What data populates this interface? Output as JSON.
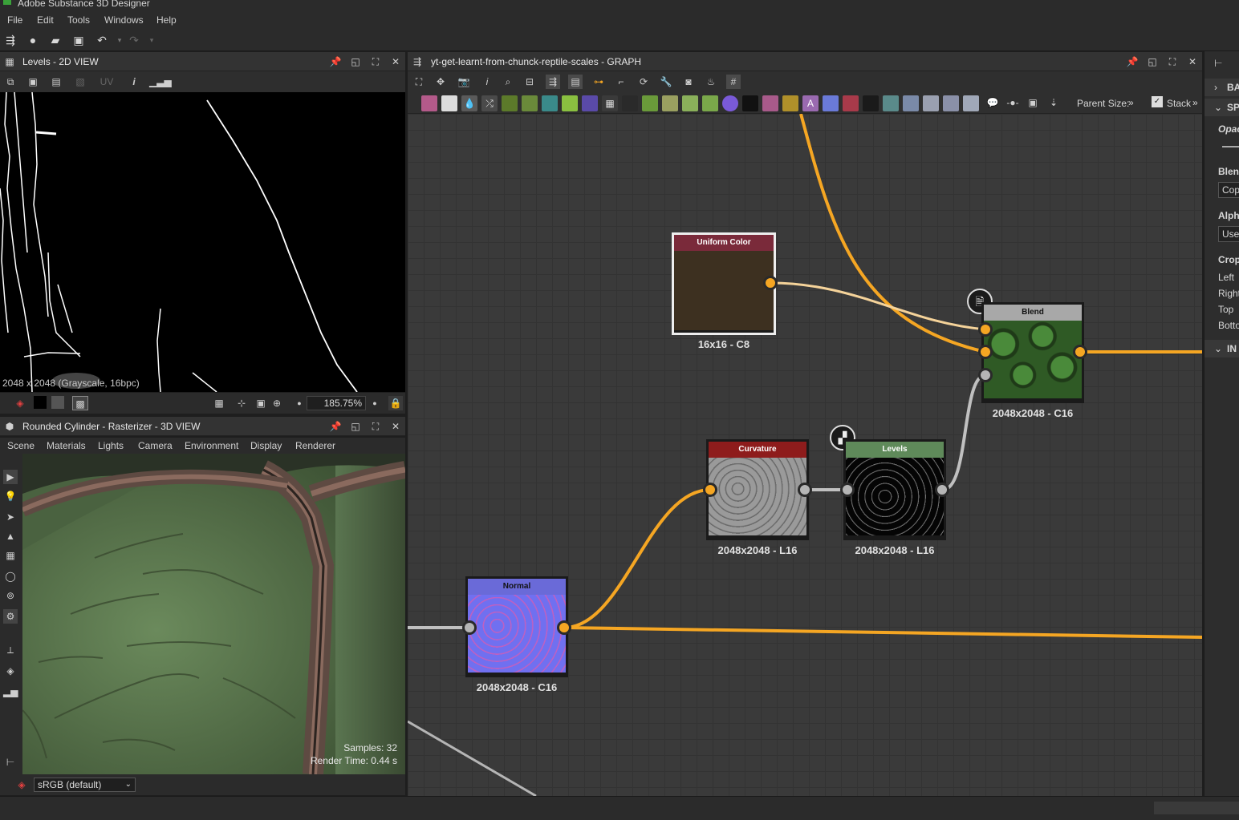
{
  "app": {
    "title": "Adobe Substance 3D Designer"
  },
  "menu": [
    "File",
    "Edit",
    "Tools",
    "Windows",
    "Help"
  ],
  "view2d": {
    "title": "Levels - 2D VIEW",
    "uv_label": "UV",
    "image_info": "2048 x 2048 (Grayscale, 16bpc)",
    "zoom": "185.75%"
  },
  "view3d": {
    "title": "Rounded Cylinder - Rasterizer - 3D VIEW",
    "menu": [
      "Scene",
      "Materials",
      "Lights",
      "Camera",
      "Environment",
      "Display",
      "Renderer"
    ],
    "samples": "Samples: 32",
    "render_time": "Render Time: 0.44 s",
    "colorspace": "sRGB (default)"
  },
  "graph": {
    "title": "yt-get-learnt-from-chunck-reptile-scales - GRAPH",
    "parent_size_label": "Parent Size:",
    "stack_label": "Stack",
    "nodes": {
      "uniform_color": {
        "name": "Uniform Color",
        "label": "16x16 - C8",
        "color": "#7a2a3a",
        "fill": "#3d3020"
      },
      "blend": {
        "name": "Blend",
        "label": "2048x2048 - C16",
        "color": "#a8a8a8"
      },
      "curvature": {
        "name": "Curvature",
        "label": "2048x2048 - L16",
        "color": "#8e1c1c"
      },
      "levels": {
        "name": "Levels",
        "label": "2048x2048 - L16",
        "color": "#5f8a5a"
      },
      "normal": {
        "name": "Normal",
        "label": "2048x2048 - C16",
        "color": "#6a6ad8"
      }
    }
  },
  "rightpanel": {
    "sections": [
      "BA",
      "SP",
      "IN"
    ],
    "labels": [
      "Opac",
      "Blend",
      "Cop",
      "Alph",
      "Use",
      "Crop",
      "Left",
      "Right",
      "Top",
      "Botto"
    ]
  },
  "colors": {
    "wire_orange": "#f5a623",
    "wire_grey": "#b5b5b5",
    "accent": "#f5a623"
  }
}
